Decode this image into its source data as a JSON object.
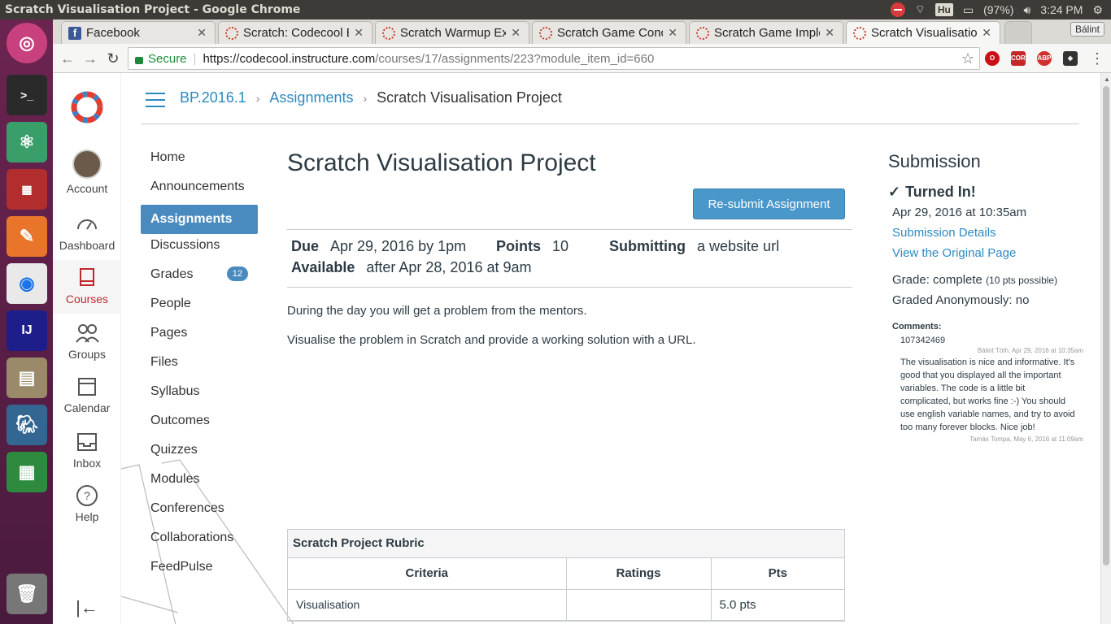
{
  "window_title": "Scratch Visualisation Project - Google Chrome",
  "tray": {
    "keyboard": "Hu",
    "battery": "(97%)",
    "clock": "3:24 PM"
  },
  "tabs": [
    {
      "title": "Facebook",
      "icon": "facebook-icon"
    },
    {
      "title": "Scratch: Codecool E",
      "icon": "canvas-icon"
    },
    {
      "title": "Scratch Warmup Ex",
      "icon": "canvas-icon"
    },
    {
      "title": "Scratch Game Conc",
      "icon": "canvas-icon"
    },
    {
      "title": "Scratch Game Imple",
      "icon": "canvas-icon"
    },
    {
      "title": "Scratch Visualisatio",
      "icon": "canvas-icon"
    }
  ],
  "profile_name": "Bálint",
  "address": {
    "secure_label": "Secure",
    "host": "https://codecool.instructure.com",
    "path": "/courses/17/assignments/223?module_item_id=660"
  },
  "global_nav": {
    "account": "Account",
    "dashboard": "Dashboard",
    "courses": "Courses",
    "groups": "Groups",
    "calendar": "Calendar",
    "inbox": "Inbox",
    "help": "Help"
  },
  "breadcrumb": {
    "course": "BP.2016.1",
    "section": "Assignments",
    "current": "Scratch Visualisation Project"
  },
  "course_nav": [
    "Home",
    "Announcements",
    "Assignments",
    "Discussions",
    "Grades",
    "People",
    "Pages",
    "Files",
    "Syllabus",
    "Outcomes",
    "Quizzes",
    "Modules",
    "Conferences",
    "Collaborations",
    "FeedPulse"
  ],
  "grades_badge": "12",
  "assignment": {
    "title": "Scratch Visualisation Project",
    "resubmit_label": "Re-submit Assignment",
    "due_label": "Due",
    "due_value": "Apr 29, 2016 by 1pm",
    "points_label": "Points",
    "points_value": "10",
    "submitting_label": "Submitting",
    "submitting_value": "a website url",
    "available_label": "Available",
    "available_value": "after Apr 28, 2016 at 9am",
    "description": [
      "During the day you will get a problem from the mentors.",
      "Visualise the problem in Scratch and provide a working solution with a URL."
    ]
  },
  "rubric": {
    "caption": "Scratch Project Rubric",
    "headers": [
      "Criteria",
      "Ratings",
      "Pts"
    ],
    "rows": [
      {
        "criteria": "Visualisation",
        "ratings": "",
        "pts": "5.0 pts"
      }
    ]
  },
  "submission": {
    "heading": "Submission",
    "status": "Turned In!",
    "date": "Apr 29, 2016 at 10:35am",
    "details_link": "Submission Details",
    "original_link": "View the Original Page",
    "grade": "Grade: complete",
    "grade_possible": "(10 pts possible)",
    "anonymous": "Graded Anonymously: no",
    "comments_label": "Comments:",
    "comment1_text": "107342469",
    "comment1_meta": "Bálint Tóth, Apr 29, 2016 at 10:35am",
    "comment2_text": "The visualisation is nice and informative. It's good that you displayed all the important variables. The code is a little bit complicated, but works fine :-) You should use english variable names, and try to avoid too many forever blocks. Nice job!",
    "comment2_meta": "Tamás Tompa, May 6, 2016 at 11:09am"
  }
}
